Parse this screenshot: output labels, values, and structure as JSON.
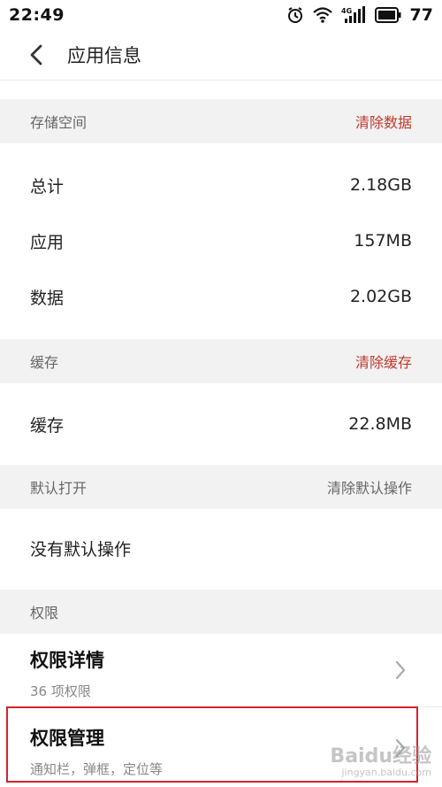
{
  "status_bar": {
    "time": "22:49",
    "network": "4G",
    "battery_level": "77"
  },
  "header": {
    "title": "应用信息",
    "back_icon": "chevron-left-icon"
  },
  "storage": {
    "section_title": "存储空间",
    "action_label": "清除数据",
    "action_color": "#c0392b",
    "rows": [
      {
        "label": "总计",
        "value": "2.18GB"
      },
      {
        "label": "应用",
        "value": "157MB"
      },
      {
        "label": "数据",
        "value": "2.02GB"
      }
    ]
  },
  "cache": {
    "section_title": "缓存",
    "action_label": "清除缓存",
    "action_color": "#c0392b",
    "rows": [
      {
        "label": "缓存",
        "value": "22.8MB"
      }
    ]
  },
  "default_open": {
    "section_title": "默认打开",
    "action_label": "清除默认操作",
    "action_color": "#666666",
    "text": "没有默认操作"
  },
  "permissions": {
    "section_title": "权限",
    "items": [
      {
        "title": "权限详情",
        "subtitle": "36 项权限"
      },
      {
        "title": "权限管理",
        "subtitle": "通知栏，弹框，定位等"
      }
    ]
  },
  "watermark": {
    "brand": "Baidu经验",
    "url": "jingyan.baidu.com"
  }
}
